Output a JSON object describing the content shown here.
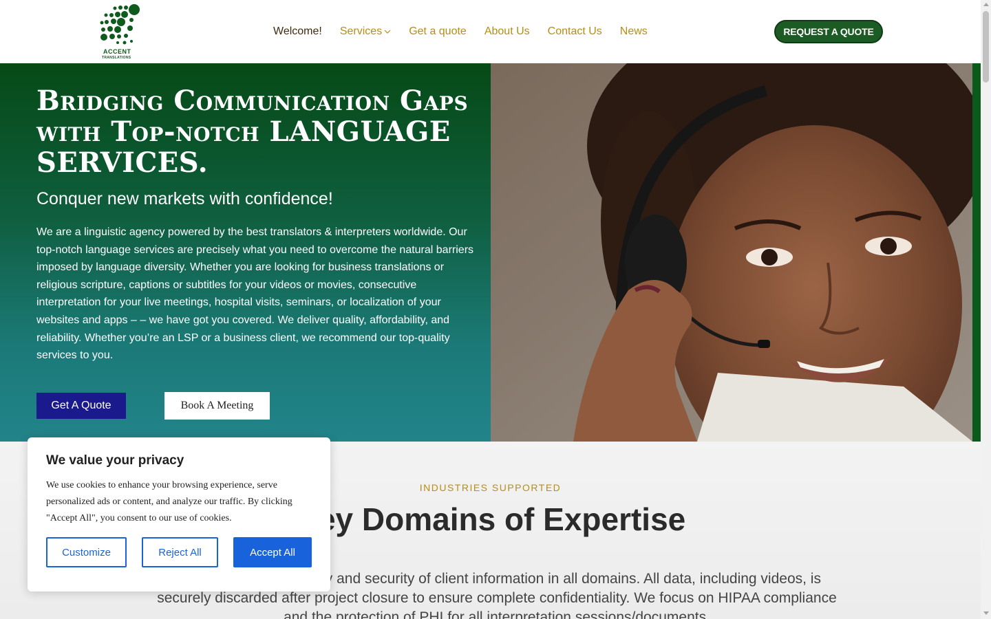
{
  "header": {
    "logo": {
      "line1": "ACCENT",
      "line2": "TRANSLATIONS",
      "brand_color": "#0f5a1d"
    },
    "nav": [
      {
        "label": "Welcome!",
        "active": true
      },
      {
        "label": "Services",
        "has_dropdown": true
      },
      {
        "label": "Get a quote"
      },
      {
        "label": "About Us"
      },
      {
        "label": "Contact Us"
      },
      {
        "label": "News"
      }
    ],
    "cta_label": "REQUEST A QUOTE",
    "colors": {
      "nav_text": "#b78d13",
      "nav_active": "#3f2a10",
      "cta_bg": "#1d5b25"
    }
  },
  "hero": {
    "title": "Bridging Communication Gaps with Top-notch LANGUAGE SERVICES.",
    "subtitle": "Conquer new markets with confidence!",
    "body": "We are a linguistic agency powered by the best translators & interpreters worldwide. Our top-notch language services are precisely what you need to overcome the natural barriers imposed by language diversity. Whether you are looking for business translations or religious scripture, captions or subtitles for your videos or movies, consecutive interpretation for your live meetings, hospital visits, seminars, or localization of your websites and apps – – we have got you covered. We deliver quality, affordability, and reliability. Whether you’re an LSP or a business client, we recommend our top-quality services to you.",
    "primary_button": "Get A Quote",
    "secondary_button": "Book A Meeting",
    "colors": {
      "gradient_top": "#064a16",
      "gradient_bottom": "#22848a",
      "primary_button_bg": "#1a1a8c"
    }
  },
  "industries": {
    "eyebrow": "INDUSTRIES SUPPORTED",
    "title": "Key Domains of Expertise",
    "body": "oritize the utmost privacy and security of client information in all domains. All data, including videos, is securely discarded after project closure to ensure complete confidentiality. We focus on HIPAA compliance and the protection of PHI for all interpretation sessions/documents."
  },
  "cookie": {
    "title": "We value your privacy",
    "text": "We use cookies to enhance your browsing experience, serve personalized ads or content, and analyze our traffic. By clicking \"Accept All\", you consent to our use of cookies.",
    "buttons": {
      "customize": "Customize",
      "reject": "Reject All",
      "accept": "Accept All"
    },
    "accent_color": "#1863dc"
  }
}
